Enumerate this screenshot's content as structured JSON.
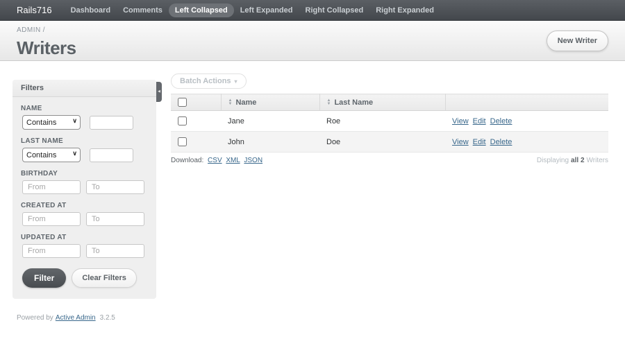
{
  "nav": {
    "brand": "Rails716",
    "tabs": [
      {
        "label": "Dashboard"
      },
      {
        "label": "Comments"
      },
      {
        "label": "Left Collapsed"
      },
      {
        "label": "Left Expanded"
      },
      {
        "label": "Right Collapsed"
      },
      {
        "label": "Right Expanded"
      }
    ],
    "active_tab": "Left Collapsed"
  },
  "header": {
    "breadcrumb": "ADMIN",
    "breadcrumb_separator": "/",
    "title": "Writers",
    "new_button": "New Writer"
  },
  "filters": {
    "panel_title": "Filters",
    "name": {
      "label": "NAME",
      "operator": "Contains",
      "value": ""
    },
    "last_name": {
      "label": "LAST NAME",
      "operator": "Contains",
      "value": ""
    },
    "birthday": {
      "label": "BIRTHDAY",
      "from_placeholder": "From",
      "to_placeholder": "To"
    },
    "created_at": {
      "label": "CREATED AT",
      "from_placeholder": "From",
      "to_placeholder": "To"
    },
    "updated_at": {
      "label": "UPDATED AT",
      "from_placeholder": "From",
      "to_placeholder": "To"
    },
    "submit_label": "Filter",
    "clear_label": "Clear Filters"
  },
  "table": {
    "batch_actions_label": "Batch Actions",
    "columns": {
      "name": "Name",
      "last_name": "Last Name"
    },
    "rows": [
      {
        "name": "Jane",
        "last_name": "Roe"
      },
      {
        "name": "John",
        "last_name": "Doe"
      }
    ],
    "row_actions": {
      "view": "View",
      "edit": "Edit",
      "delete": "Delete"
    }
  },
  "index_footer": {
    "download_label": "Download:",
    "formats": [
      "CSV",
      "XML",
      "JSON"
    ],
    "displaying_prefix": "Displaying",
    "displaying_strong": "all 2",
    "displaying_suffix": "Writers"
  },
  "footer": {
    "powered_by": "Powered by",
    "link": "Active Admin",
    "version": "3.2.5"
  },
  "icons": {
    "caret_down": "▾",
    "chevron_down": "∨",
    "sort_asc": "▲",
    "sort_desc": "▼",
    "collapse_left": "◀"
  },
  "colors": {
    "link": "#38678b",
    "nav_background_top": "#5b5f64",
    "nav_background_bottom": "#43474c",
    "nav_active_bg": "#6d7176",
    "accent_text": "#5b6166",
    "sidebar_bg": "#efefef"
  }
}
